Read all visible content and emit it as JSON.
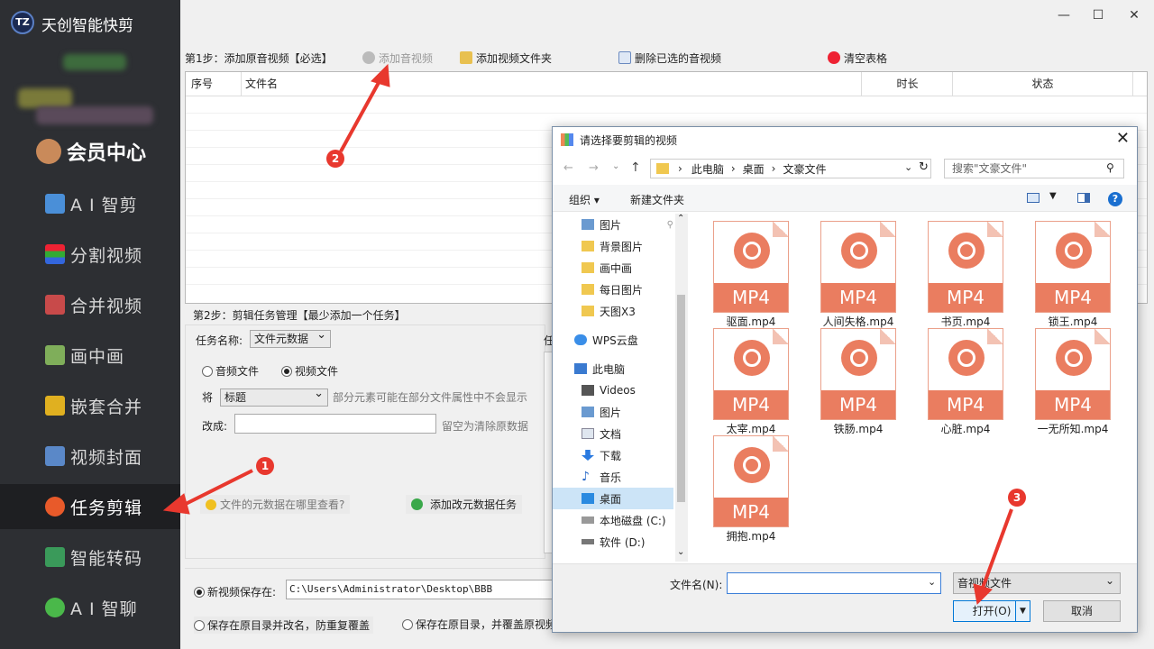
{
  "app": {
    "name": "天创智能快剪",
    "logo_text": "TZ"
  },
  "window": {
    "minimize": "—",
    "maximize": "☐",
    "close": "✕"
  },
  "sidebar": {
    "member": "会员中心",
    "items": [
      {
        "label": "A I 智剪",
        "icon": "ai-edit-icon"
      },
      {
        "label": "分割视频",
        "icon": "split-video-icon"
      },
      {
        "label": "合并视频",
        "icon": "merge-video-icon"
      },
      {
        "label": "画中画",
        "icon": "picture-in-picture-icon"
      },
      {
        "label": "嵌套合并",
        "icon": "nest-merge-icon"
      },
      {
        "label": "视频封面",
        "icon": "video-cover-icon"
      },
      {
        "label": "任务剪辑",
        "icon": "task-edit-icon"
      },
      {
        "label": "智能转码",
        "icon": "transcode-icon"
      },
      {
        "label": "A I 智聊",
        "icon": "ai-chat-icon"
      }
    ],
    "active_index": 6
  },
  "step1": {
    "label": "第1步：添加原音视频【必选】",
    "add_video": "添加音视频",
    "add_folder": "添加视频文件夹",
    "delete_selected": "删除已选的音视频",
    "clear_table": "清空表格",
    "columns": [
      "序号",
      "文件名",
      "时长",
      "状态"
    ]
  },
  "step2": {
    "label": "第2步：剪辑任务管理【最少添加一个任务】",
    "task_name_label": "任务名称:",
    "task_name_value": "文件元数据",
    "radio_audio": "音频文件",
    "radio_video": "视频文件",
    "jiang": "将",
    "field_value": "标题",
    "field_hint": "部分元素可能在部分文件属性中不会显示",
    "change_label": "改成:",
    "change_value": "",
    "change_hint": "留空为清除原数据",
    "help_link": "文件的元数据在哪里查看?",
    "add_task": "添加改元数据任务",
    "task_list_header": "任"
  },
  "output": {
    "save_label": "新视频保存在:",
    "save_path": "C:\\Users\\Administrator\\Desktop\\BBB",
    "opt_rename": "保存在原目录并改名，防重复覆盖",
    "opt_overwrite": "保存在原目录，并覆盖原视频"
  },
  "dialog": {
    "title": "请选择要剪辑的视频",
    "breadcrumb": [
      "此电脑",
      "桌面",
      "文豪文件"
    ],
    "search_placeholder": "搜索\"文豪文件\"",
    "organize": "组织 ▾",
    "new_folder": "新建文件夹",
    "tree": [
      {
        "label": "图片",
        "icon": "pictures-icon"
      },
      {
        "label": "背景图片",
        "icon": "folder-icon"
      },
      {
        "label": "画中画",
        "icon": "folder-icon"
      },
      {
        "label": "每日图片",
        "icon": "folder-icon"
      },
      {
        "label": "天图X3",
        "icon": "folder-icon"
      },
      {
        "label": "WPS云盘",
        "icon": "cloud-icon"
      },
      {
        "label": "此电脑",
        "icon": "computer-icon"
      },
      {
        "label": "Videos",
        "icon": "videos-icon"
      },
      {
        "label": "图片",
        "icon": "pictures-icon"
      },
      {
        "label": "文档",
        "icon": "documents-icon"
      },
      {
        "label": "下载",
        "icon": "download-icon"
      },
      {
        "label": "音乐",
        "icon": "music-icon"
      },
      {
        "label": "桌面",
        "icon": "desktop-icon"
      },
      {
        "label": "本地磁盘 (C:)",
        "icon": "drive-icon"
      },
      {
        "label": "软件 (D:)",
        "icon": "drive-icon"
      }
    ],
    "files": [
      "驱面.mp4",
      "人间失格.mp4",
      "书页.mp4",
      "锁王.mp4",
      "太宰.mp4",
      "铁肠.mp4",
      "心脏.mp4",
      "一无所知.mp4",
      "拥抱.mp4"
    ],
    "file_badge": "MP4",
    "filename_label": "文件名(N):",
    "filename_value": "",
    "filetype": "音视频文件",
    "open": "打开(O)",
    "cancel": "取消"
  },
  "annotations": [
    "1",
    "2",
    "3"
  ],
  "colors": {
    "sidebar": "#2d2f33",
    "accent_red": "#e8382e",
    "mp4": "#ea7d60",
    "selected": "#cce4f7"
  }
}
